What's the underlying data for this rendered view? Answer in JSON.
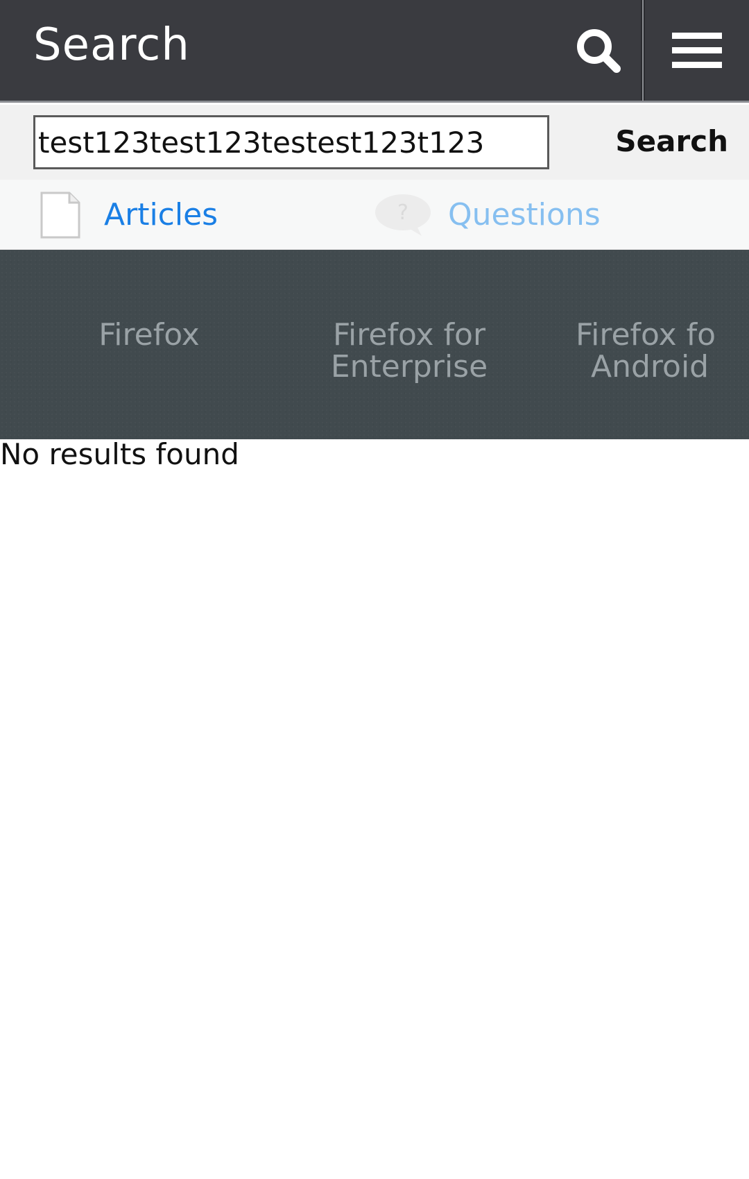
{
  "header": {
    "title": "Search",
    "search_icon": "search-icon",
    "menu_icon": "hamburger-menu-icon",
    "background": "#3a3b40"
  },
  "search": {
    "value": "test123test123testest123t123",
    "submit_label": "Search"
  },
  "tabs": [
    {
      "label": "Articles",
      "icon": "document-icon",
      "color": "#1a7fe5"
    },
    {
      "label": "Questions",
      "icon": "question-bubble-icon",
      "color": "#86bff0"
    }
  ],
  "products": {
    "items": [
      {
        "line1": "Firefox",
        "line2": ""
      },
      {
        "line1": "Firefox for",
        "line2": "Enterprise"
      },
      {
        "line1": "Firefox for",
        "line2": "Android"
      }
    ],
    "background": "#414a4e"
  },
  "results": {
    "empty_message": "No results found"
  }
}
